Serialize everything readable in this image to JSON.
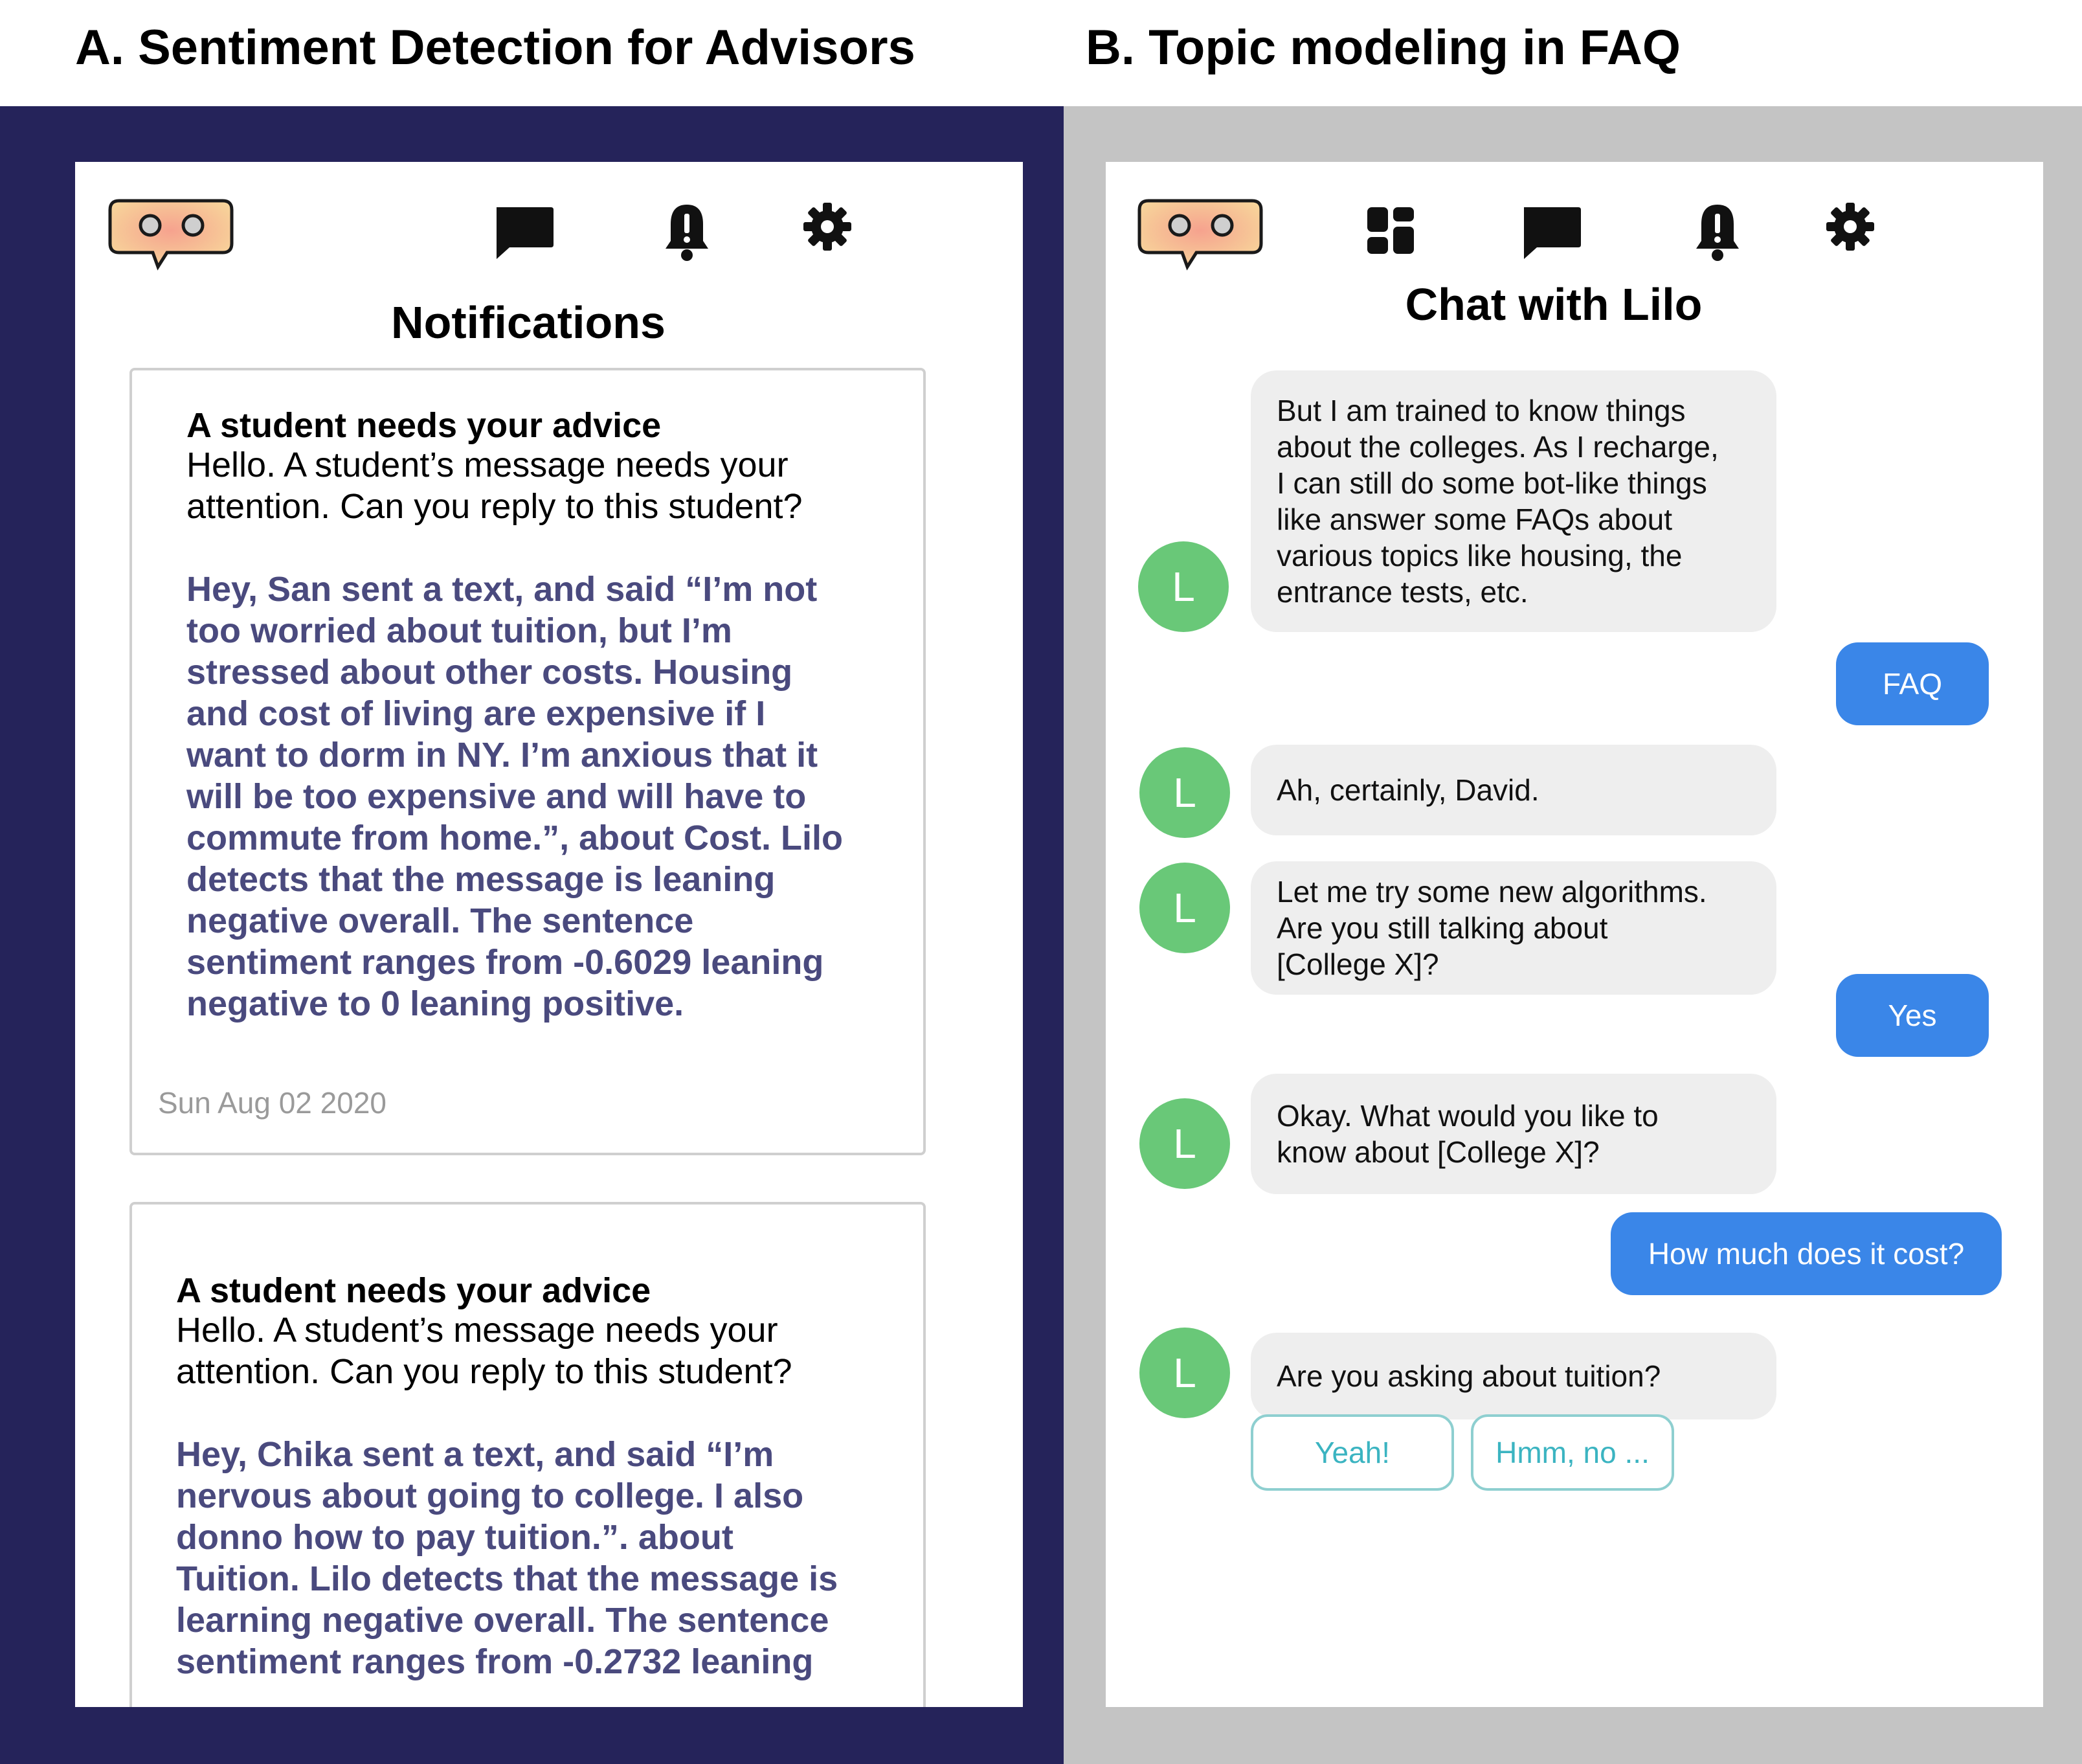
{
  "panel_a": {
    "heading": "A. Sentiment Detection for Advisors",
    "screen_title": "Notifications",
    "nav": {
      "icons": [
        "lilo-logo-icon",
        "chat-icon",
        "bell-icon",
        "gear-icon"
      ]
    },
    "notifications": [
      {
        "title": "A student needs your advice",
        "intro": "Hello. A student’s message needs your\nattention. Can you reply to this student?",
        "message": "Hey, San sent a text, and said “I’m not\ntoo worried about tuition, but I’m\nstressed about other costs. Housing\nand cost of living are expensive if I\nwant to dorm in NY. I’m anxious that it\nwill be too expensive and will have to\ncommute from home.”, about Cost. Lilo\ndetects that the message is leaning\nnegative overall. The sentence\nsentiment ranges from -0.6029 leaning\nnegative to 0 leaning positive.",
        "date": "Sun Aug 02 2020"
      },
      {
        "title": "A student needs your advice",
        "intro": "Hello. A student’s message needs your\nattention. Can you reply to this student?",
        "message": "Hey, Chika sent a text, and said “I’m\nnervous about going to college. I also\ndonno how to pay tuition.”. about\nTuition. Lilo detects that the message is\nlearning negative overall. The sentence\nsentiment ranges from -0.2732 leaning"
      }
    ]
  },
  "panel_b": {
    "heading": "B. Topic modeling in FAQ",
    "screen_title": "Chat with Lilo",
    "nav": {
      "icons": [
        "lilo-logo-icon",
        "dashboard-icon",
        "chat-icon",
        "bell-icon",
        "gear-icon"
      ]
    },
    "avatar_letter": "L",
    "messages": [
      {
        "from": "bot",
        "text": "But I am trained to know things\nabout the colleges. As I recharge,\nI can still do some bot-like things\nlike answer some FAQs about\nvarious topics like housing, the\nentrance tests, etc."
      },
      {
        "from": "user",
        "text": "FAQ"
      },
      {
        "from": "bot",
        "text": "Ah, certainly, David."
      },
      {
        "from": "bot",
        "text": "Let me try some new algorithms.\nAre you still talking about\n[College X]?"
      },
      {
        "from": "user",
        "text": "Yes"
      },
      {
        "from": "bot",
        "text": "Okay. What would you like to\nknow about [College X]?"
      },
      {
        "from": "user",
        "text": "How much does it cost?"
      },
      {
        "from": "bot",
        "text": "Are you asking about tuition?"
      }
    ],
    "quick_replies": [
      "Yeah!",
      "Hmm, no ..."
    ]
  },
  "colors": {
    "panel_a_background": "#25235a",
    "panel_b_background": "#c4c4c4",
    "message_text": "#4a4a7e",
    "bot_bubble": "#eeeeee",
    "user_bubble": "#3a86e8",
    "avatar": "#69c878",
    "quick_reply_text": "#3bb4c1"
  }
}
